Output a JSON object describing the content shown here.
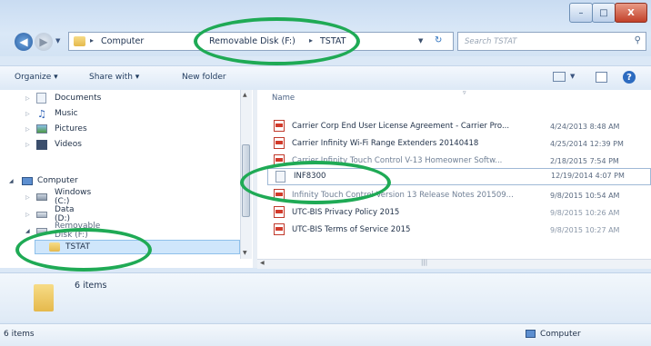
{
  "window": {
    "buttons": {
      "minimize": "–",
      "maximize": "□",
      "close": "X"
    }
  },
  "address": {
    "crumbs": [
      "Computer",
      "Removable Disk (F:)",
      "TSTAT"
    ],
    "separator": "▸"
  },
  "search": {
    "placeholder": "Search TSTAT"
  },
  "toolbar": {
    "organize": "Organize ▾",
    "share_with": "Share with ▾",
    "new_folder": "New folder"
  },
  "nav": {
    "items": [
      {
        "label": "Documents"
      },
      {
        "label": "Music"
      },
      {
        "label": "Pictures"
      },
      {
        "label": "Videos"
      },
      {
        "label": "Computer"
      },
      {
        "label": "Windows (C:)"
      },
      {
        "label": "Data (D:)"
      },
      {
        "label": "Removable Disk (F:)"
      },
      {
        "label": "TSTAT"
      }
    ]
  },
  "content": {
    "column_name": "Name",
    "files": [
      {
        "name": "Carrier Corp End User License Agreement - Carrier Pro...",
        "date": "4/24/2013 8:48 AM",
        "type": "pdf"
      },
      {
        "name": "Carrier Infinity Wi-Fi Range Extenders 20140418",
        "date": "4/25/2014 12:39 PM",
        "type": "pdf"
      },
      {
        "name": "Carrier Infinity Touch Control V-13 Homeowner Softw...",
        "date": "2/18/2015 7:54 PM",
        "type": "pdf"
      },
      {
        "name": "INF8300",
        "date": "12/19/2014 4:07 PM",
        "type": "txt"
      },
      {
        "name": "Infinity Touch Control Version 13 Release Notes 201509...",
        "date": "9/8/2015 10:54 AM",
        "type": "pdf"
      },
      {
        "name": "UTC-BIS Privacy Policy 2015",
        "date": "9/8/2015 10:26 AM",
        "type": "pdf"
      },
      {
        "name": "UTC-BIS Terms of Service 2015",
        "date": "9/8/2015 10:27 AM",
        "type": "pdf"
      }
    ]
  },
  "details": {
    "count": "6 items"
  },
  "status": {
    "left": "6 items",
    "right": "Computer"
  },
  "colors": {
    "highlight": "#1faa55",
    "selected": "#cfe6fb"
  }
}
